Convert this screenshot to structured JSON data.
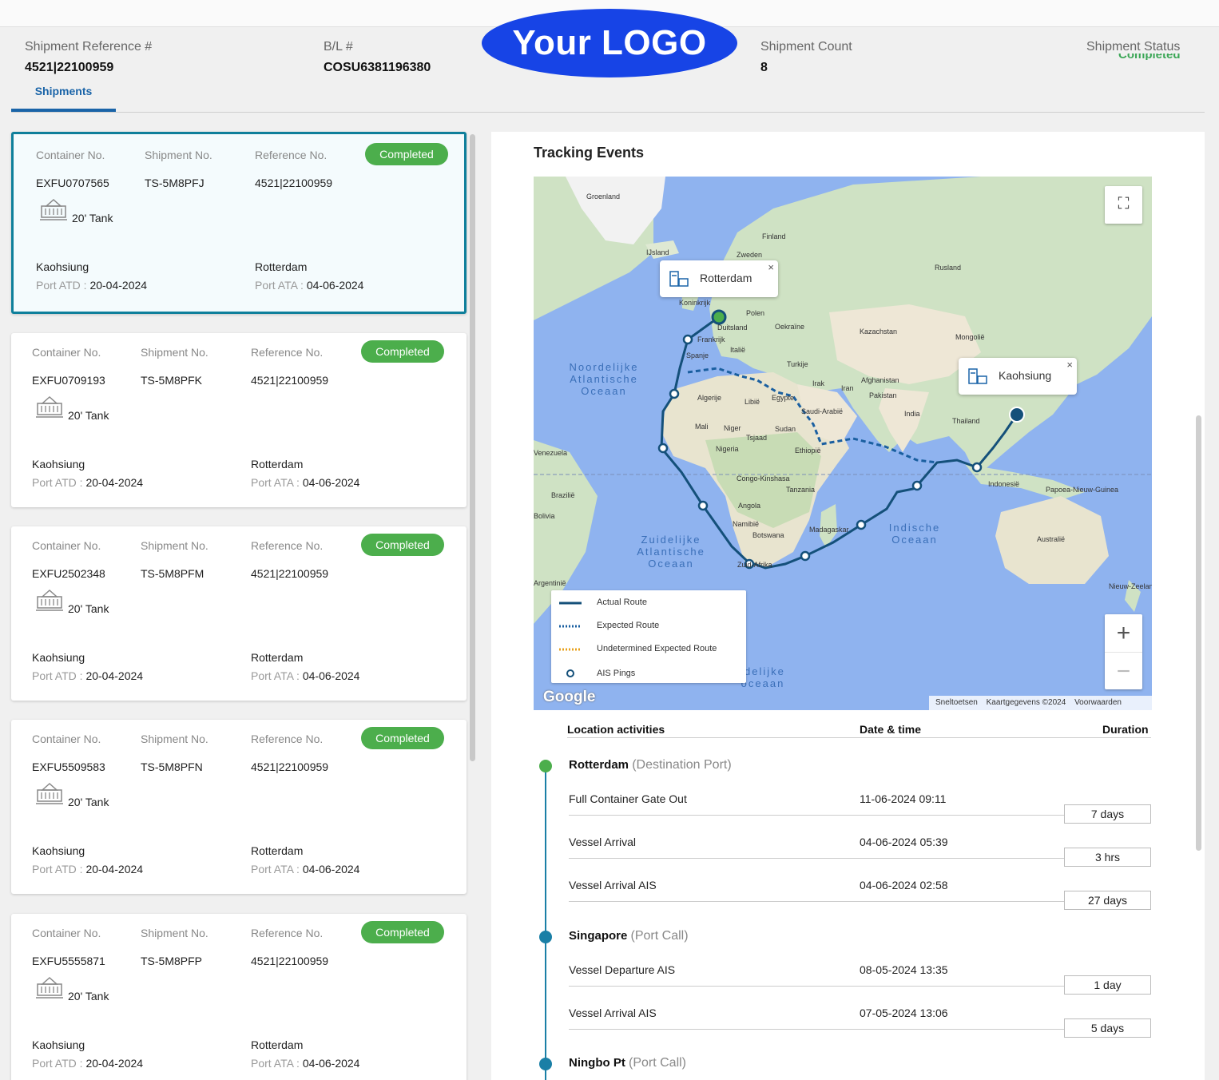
{
  "header": {
    "shipment_ref_label": "Shipment Reference #",
    "shipment_ref_value": "4521|22100959",
    "bl_label": "B/L #",
    "bl_value": "COSU6381196380",
    "logo_text": "Your LOGO",
    "count_label": "Shipment Count",
    "count_value": "8",
    "status_label": "Shipment Status",
    "status_value": "Completed",
    "tab_label": "Shipments"
  },
  "cards": [
    {
      "container_label": "Container No.",
      "shipment_label": "Shipment No.",
      "reference_label": "Reference No.",
      "status": "Completed",
      "container": "EXFU0707565",
      "shipment": "TS-5M8PFJ",
      "reference": "4521|22100959",
      "type": "20' Tank",
      "origin": "Kaohsiung",
      "origin_sub_label": "Port ATD :",
      "origin_date": "20-04-2024",
      "dest": "Rotterdam",
      "dest_sub_label": "Port ATA :",
      "dest_date": "04-06-2024"
    },
    {
      "container_label": "Container No.",
      "shipment_label": "Shipment No.",
      "reference_label": "Reference No.",
      "status": "Completed",
      "container": "EXFU0709193",
      "shipment": "TS-5M8PFK",
      "reference": "4521|22100959",
      "type": "20' Tank",
      "origin": "Kaohsiung",
      "origin_sub_label": "Port ATD :",
      "origin_date": "20-04-2024",
      "dest": "Rotterdam",
      "dest_sub_label": "Port ATA :",
      "dest_date": "04-06-2024"
    },
    {
      "container_label": "Container No.",
      "shipment_label": "Shipment No.",
      "reference_label": "Reference No.",
      "status": "Completed",
      "container": "EXFU2502348",
      "shipment": "TS-5M8PFM",
      "reference": "4521|22100959",
      "type": "20' Tank",
      "origin": "Kaohsiung",
      "origin_sub_label": "Port ATD :",
      "origin_date": "20-04-2024",
      "dest": "Rotterdam",
      "dest_sub_label": "Port ATA :",
      "dest_date": "04-06-2024"
    },
    {
      "container_label": "Container No.",
      "shipment_label": "Shipment No.",
      "reference_label": "Reference No.",
      "status": "Completed",
      "container": "EXFU5509583",
      "shipment": "TS-5M8PFN",
      "reference": "4521|22100959",
      "type": "20' Tank",
      "origin": "Kaohsiung",
      "origin_sub_label": "Port ATD :",
      "origin_date": "20-04-2024",
      "dest": "Rotterdam",
      "dest_sub_label": "Port ATA :",
      "dest_date": "04-06-2024"
    },
    {
      "container_label": "Container No.",
      "shipment_label": "Shipment No.",
      "reference_label": "Reference No.",
      "status": "Completed",
      "container": "EXFU5555871",
      "shipment": "TS-5M8PFP",
      "reference": "4521|22100959",
      "type": "20' Tank",
      "origin": "Kaohsiung",
      "origin_sub_label": "Port ATD :",
      "origin_date": "20-04-2024",
      "dest": "Rotterdam",
      "dest_sub_label": "Port ATA :",
      "dest_date": "04-06-2024"
    }
  ],
  "tracking": {
    "title": "Tracking Events",
    "map": {
      "popup_dest": "Rotterdam",
      "popup_origin": "Kaohsiung",
      "close_glyph": "×",
      "fullscreen_glyph": "⛶",
      "zoom_in": "+",
      "zoom_out": "−",
      "google": "Google",
      "attrib_shortcuts": "Sneltoetsen",
      "attrib_data": "Kaartgegevens ©2024",
      "attrib_terms": "Voorwaarden",
      "oceans": {
        "north_atlantic": "Noordelijke Atlantische Oceaan",
        "south_atlantic": "Zuidelijke Atlantische Oceaan",
        "indian": "Indische Oceaan",
        "partial_south": "idelijke oceaan"
      },
      "labels": [
        "Groenland",
        "Finland",
        "IJsland",
        "Zweden",
        "Rusland",
        "Koninkrijk",
        "Polen",
        "Duitsland",
        "Oekraïne",
        "Frankrijk",
        "Kazachstan",
        "Mongolië",
        "Italië",
        "Spanje",
        "Turkije",
        "Afghanistan",
        "Irak",
        "Iran",
        "Pakistan",
        "Algerije",
        "Libië",
        "Egypte",
        "Saudi-Arabië",
        "India",
        "Thailand",
        "Mali",
        "Niger",
        "Tsjaad",
        "Sudan",
        "Nigeria",
        "Ethiopië",
        "Congo-Kinshasa",
        "Tanzania",
        "Angola",
        "Namibië",
        "Botswana",
        "Madagaskar",
        "Zuid-Afrika",
        "Indonesië",
        "Papoea-Nieuw-Guinea",
        "Australië",
        "Brazilië",
        "Bolivia",
        "Argentinië",
        "Venezuela",
        "Nieuw-Zeeland"
      ],
      "legend": [
        {
          "label": "Actual Route",
          "color": "#14507a"
        },
        {
          "label": "Expected Route",
          "color": "#1a5fa0"
        },
        {
          "label": "Undetermined Expected Route",
          "color": "#e9a21d"
        },
        {
          "label": "AIS Pings",
          "color": "#14507a"
        }
      ]
    },
    "columns": {
      "location": "Location activities",
      "datetime": "Date & time",
      "duration": "Duration"
    },
    "locations": [
      {
        "name": "Rotterdam",
        "type": "(Destination Port)",
        "dot_color": "#4cae4c",
        "events": [
          {
            "name": "Full Container Gate Out",
            "date": "11-06-2024 09:11",
            "duration": "7 days"
          },
          {
            "name": "Vessel Arrival",
            "date": "04-06-2024 05:39",
            "duration": "3 hrs"
          },
          {
            "name": "Vessel Arrival AIS",
            "date": "04-06-2024 02:58",
            "duration": "27 days"
          }
        ]
      },
      {
        "name": "Singapore",
        "type": "(Port Call)",
        "dot_color": "#1a7fa6",
        "events": [
          {
            "name": "Vessel Departure AIS",
            "date": "08-05-2024 13:35",
            "duration": "1 day"
          },
          {
            "name": "Vessel Arrival AIS",
            "date": "07-05-2024 13:06",
            "duration": "5 days"
          }
        ]
      },
      {
        "name": "Ningbo Pt",
        "type": "(Port Call)",
        "dot_color": "#1a7fa6",
        "events": []
      }
    ]
  }
}
